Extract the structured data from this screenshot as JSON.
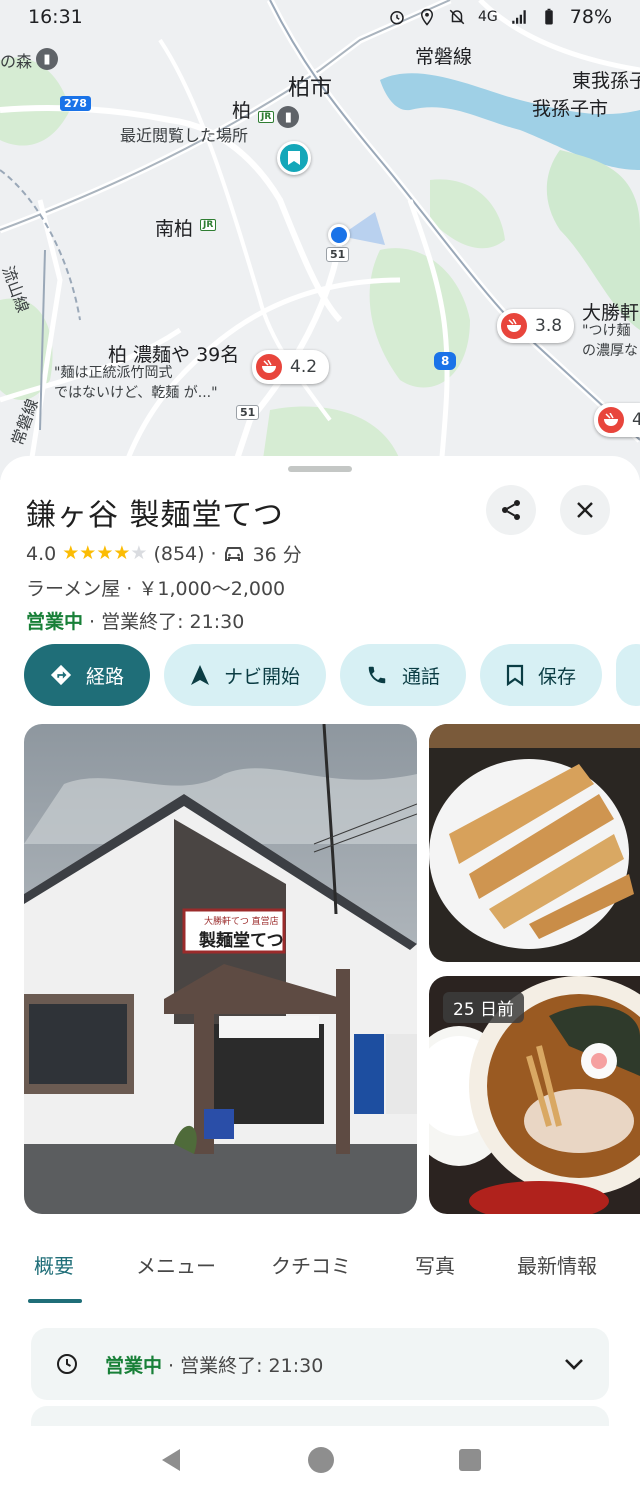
{
  "status_bar": {
    "time": "16:31",
    "network": "4G",
    "battery": "78%"
  },
  "map": {
    "labels": {
      "mori": "の森",
      "kashiwa_city": "柏市",
      "kashiwa": "柏",
      "recent": "最近閲覧した場所",
      "minami_kashiwa": "南柏",
      "joban_line": "常磐線",
      "higashi_abiko": "東我孫子",
      "abiko_city": "我孫子市",
      "nagareyama_line": "流山線",
      "joban_line_v": "常磐線",
      "taishoken": "大勝軒",
      "taishoken_snip1": "\"つけ麺",
      "taishoken_snip2": "の濃厚な",
      "noumen_title": "柏 濃麺や 39名",
      "noumen_snip1": "\"麺は正統派竹岡式",
      "noumen_snip2": "ではないけど、乾麺 が...\""
    },
    "shields": {
      "r278": "278",
      "r51a": "51",
      "r51b": "51",
      "r8": "8"
    },
    "pins": {
      "p42": "4.2",
      "p38": "3.8",
      "p4": "4"
    }
  },
  "place": {
    "name": "鎌ヶ谷 製麺堂てつ",
    "rating": "4.0",
    "rating_value": 4.0,
    "reviews": "(854)",
    "separator": "·",
    "drive_time": "36 分",
    "category": "ラーメン屋 · ￥1,000～2,000",
    "status_open": "営業中",
    "status_close": "· 営業終了: 21:30"
  },
  "actions": {
    "directions": "経路",
    "navigate": "ナビ開始",
    "call": "通話",
    "save": "保存"
  },
  "photos": {
    "badge": "25 日前",
    "sign_text": "製麺堂てつ",
    "sign_small": "大勝軒てつ 直営店"
  },
  "tabs": [
    "概要",
    "メニュー",
    "クチコミ",
    "写真",
    "最新情報"
  ],
  "hours": {
    "open": "営業中",
    "close": "· 営業終了: 21:30"
  },
  "colors": {
    "accent": "#1f6e78",
    "chip": "#d7f0f4",
    "open_green": "#188038",
    "star": "#fbbc04"
  },
  "icons": [
    "share-icon",
    "close-icon",
    "directions-icon",
    "navigation-arrow-icon",
    "phone-icon",
    "bookmark-icon",
    "clock-icon",
    "chevron-down-icon",
    "back-nav-icon",
    "home-nav-icon",
    "recents-nav-icon"
  ]
}
